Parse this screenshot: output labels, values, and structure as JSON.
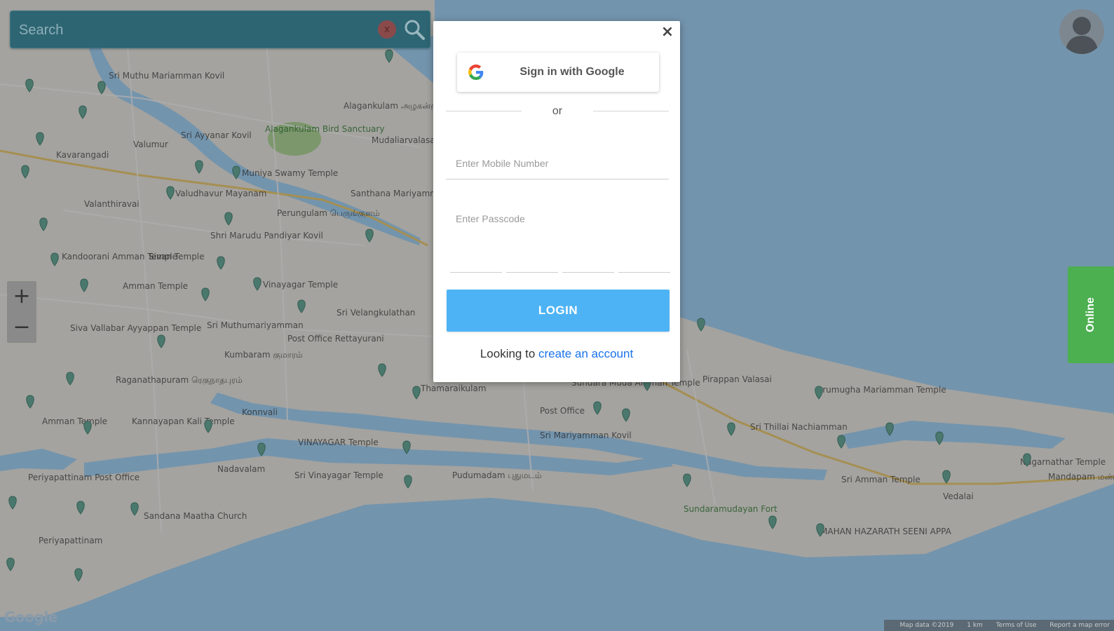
{
  "search": {
    "placeholder": "Search",
    "clear_icon": "x"
  },
  "zoom": {
    "in": "+",
    "out": "−"
  },
  "online_tab": {
    "label": "Online"
  },
  "modal": {
    "close": "×",
    "google_button": "Sign in with Google",
    "divider": "or",
    "mobile_placeholder": "Enter Mobile Number",
    "passcode_label": "Enter Passcode",
    "login_button": "LOGIN",
    "footer_prefix": "Looking to ",
    "footer_link": "create an account"
  },
  "map": {
    "logo": "Google",
    "footer": [
      "Map data ©2019",
      "1 km",
      "Terms of Use",
      "Report a map error"
    ],
    "labels": [
      "Sri Muthu Mariamman Kovil",
      "Alagankulam அழகன்குளம்",
      "Mudaliarvalasai",
      "Sri Ayyanar Kovil",
      "Alagankulam Bird Sanctuary",
      "Valumur",
      "Kavarangadi",
      "Muniya Swamy Temple",
      "Valudhavur Mayanam",
      "Santhana Mariyamman Temple",
      "Valanthiravai",
      "Perungulam பெருங்குளம்",
      "Shri Marudu Pandiyar Kovil",
      "Kandoorani Amman Temple",
      "Sivan Temple",
      "Amman Temple",
      "Vinayagar Temple",
      "Sri Velangkulathan",
      "Sri Muthumariyamman",
      "Siva Vallabar Ayyappan Temple",
      "Post Office Rettayurani",
      "Kumbaram குமாரம்",
      "Raganathapuram ரெகுநாதபுரம்",
      "Thamaraikulam",
      "Sundara Muda Amman Temple",
      "Pirappan Valasai",
      "Post Office",
      "Amman Temple",
      "Kannayapan Kali Temple",
      "Konnvali",
      "Sri Mariyamman Kovil",
      "Sri Thillai Nachiamman",
      "Arumugha Mariamman Temple",
      "VINAYAGAR Temple",
      "Nadavalam",
      "Periyapattinam Post Office",
      "Sri Vinayagar Temple",
      "Pudumadam புதுமடம்",
      "Sri Amman Temple",
      "Nagarnathar Temple",
      "Mandapam மண்டபம்",
      "Sundaramudayan Fort",
      "Vedalai",
      "Sandana Maatha Church",
      "Periyapattinam",
      "MAHAN HAZARATH SEENI APPA"
    ]
  }
}
